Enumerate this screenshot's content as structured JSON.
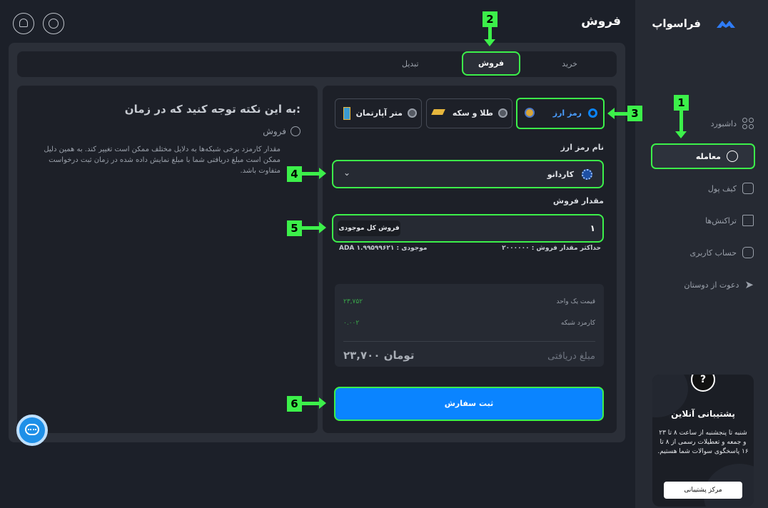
{
  "brand": {
    "name": "فراسواپ"
  },
  "header": {
    "title": "فروش"
  },
  "sidebar": {
    "items": [
      {
        "label": "داشبورد",
        "icon": "grid-icon"
      },
      {
        "label": "معامله",
        "icon": "exchange-icon"
      },
      {
        "label": "کیف پول",
        "icon": "wallet-icon"
      },
      {
        "label": "تراکنش‌ها",
        "icon": "receipt-icon"
      },
      {
        "label": "حساب کاربری",
        "icon": "user-icon"
      },
      {
        "label": "دعوت از دوستان",
        "icon": "send-icon"
      }
    ]
  },
  "support": {
    "title": "پشتیبانی آنلاین",
    "text": "شنبه تا پنجشنبه از ساعت ۸ تا ۲۳ و جمعه و تعطیلات رسمی از ۸ تا ۱۶ پاسخگوی سوالات شما هستیم.",
    "button": "مرکز پشتیبانی",
    "icon_glyph": "?"
  },
  "tabs": [
    "خرید",
    "فروش",
    "تبدیل"
  ],
  "asset_types": [
    "رمز ارز",
    "طلا و سکه",
    "متر آپارتمان"
  ],
  "form": {
    "coin_label": "نام رمز ارز",
    "coin_value": "کاردانو",
    "amount_label": "مقدار فروش",
    "amount_value": "۱",
    "sell_all_button": "فروش کل موجودی",
    "max_amount": "حداکثر مقدار فروش : ۲۰۰۰۰۰۰",
    "balance": "موجودی : ADA ۱.۹۹۵۹۹۶۲۱",
    "unit_price_label": "قیمت یک واحد",
    "unit_price_value": "۲۳,۷۵۲",
    "network_fee_label": "کارمزد شبکه",
    "network_fee_value": "۰.۰۰۲",
    "receive_label": "مبلغ دریافتی",
    "receive_value": "۲۳,۷۰۰ تومان",
    "submit_button": "ثبت سفارش"
  },
  "notice": {
    "title": "به این نکته توجه کنید که در زمان:",
    "subtitle": "فروش",
    "text": "مقدار کارمزد برخی شبکه‌ها به دلایل مختلف ممکن است تغییر کند. به همین دلیل ممکن است مبلغ دریافتی شما با مبلغ نمایش داده شده در زمان ثبت درخواست متفاوت باشد."
  },
  "annotations": [
    "1",
    "2",
    "3",
    "4",
    "5",
    "6"
  ],
  "colors": {
    "accent": "#0a84ff",
    "highlight": "#3cf04a",
    "positive": "#39a84a",
    "background": "#1c2029"
  }
}
